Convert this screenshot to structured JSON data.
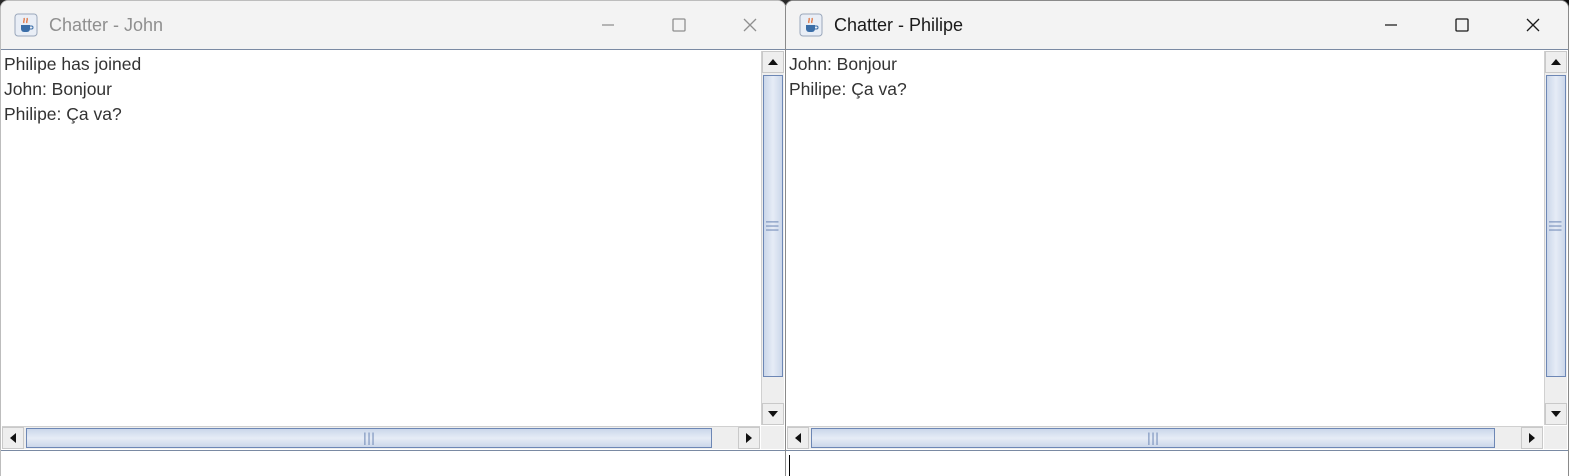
{
  "windows": [
    {
      "title": "Chatter - John",
      "active": false,
      "messages": [
        "Philipe has joined",
        "John: Bonjour",
        "Philipe: Ça va?"
      ],
      "input_value": ""
    },
    {
      "title": "Chatter - Philipe",
      "active": true,
      "messages": [
        "John: Bonjour",
        "Philipe: Ça va?"
      ],
      "input_value": ""
    }
  ],
  "icons": {
    "app": "java-cup-icon",
    "minimize": "minimize-icon",
    "maximize": "maximize-icon",
    "close": "close-icon",
    "scroll_up": "arrow-up-icon",
    "scroll_down": "arrow-down-icon",
    "scroll_left": "arrow-left-icon",
    "scroll_right": "arrow-right-icon"
  },
  "colors": {
    "scroll_thumb_border": "#6d87b5",
    "scroll_thumb_fill": "#cbd7ea",
    "titlebar_bg": "#f3f3f3",
    "inactive_title": "#8f8f8f"
  }
}
